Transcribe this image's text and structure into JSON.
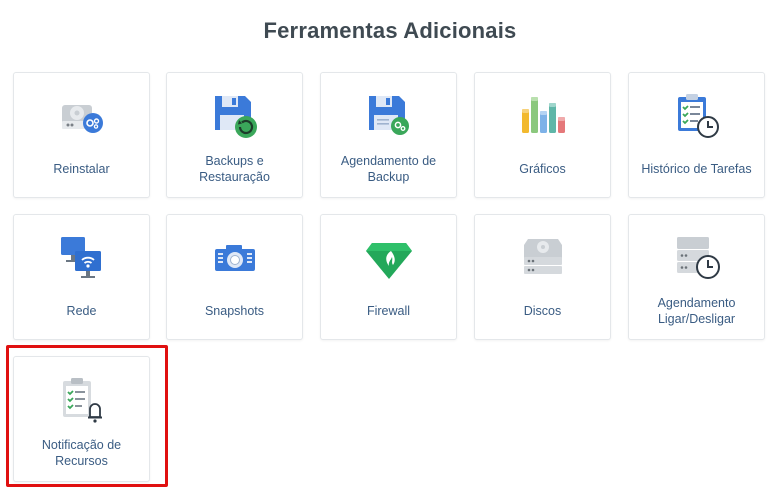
{
  "page": {
    "title": "Ferramentas Adicionais"
  },
  "tools": [
    {
      "id": "reinstall",
      "label": "Reinstalar",
      "icon": "reinstall-gear-icon"
    },
    {
      "id": "backups",
      "label": "Backups e Restauração",
      "icon": "floppy-restore-icon"
    },
    {
      "id": "schedule",
      "label": "Agendamento de Backup",
      "icon": "floppy-schedule-icon"
    },
    {
      "id": "charts",
      "label": "Gráficos",
      "icon": "bar-chart-icon"
    },
    {
      "id": "history",
      "label": "Histórico de Tarefas",
      "icon": "clipboard-clock-icon"
    },
    {
      "id": "network",
      "label": "Rede",
      "icon": "network-monitors-icon"
    },
    {
      "id": "snapshots",
      "label": "Snapshots",
      "icon": "camera-icon"
    },
    {
      "id": "firewall",
      "label": "Firewall",
      "icon": "firewall-gem-icon"
    },
    {
      "id": "disks",
      "label": "Discos",
      "icon": "disks-icon"
    },
    {
      "id": "power",
      "label": "Agendamento Ligar/Desligar",
      "icon": "server-clock-icon"
    },
    {
      "id": "notify",
      "label": "Notificação de Recursos",
      "icon": "clipboard-bell-icon"
    }
  ],
  "colors": {
    "label": "#3a5c83",
    "title": "#3f4a52",
    "accent_blue": "#3b7ad9",
    "accent_green": "#3aa75a",
    "highlight": "#e01010"
  }
}
